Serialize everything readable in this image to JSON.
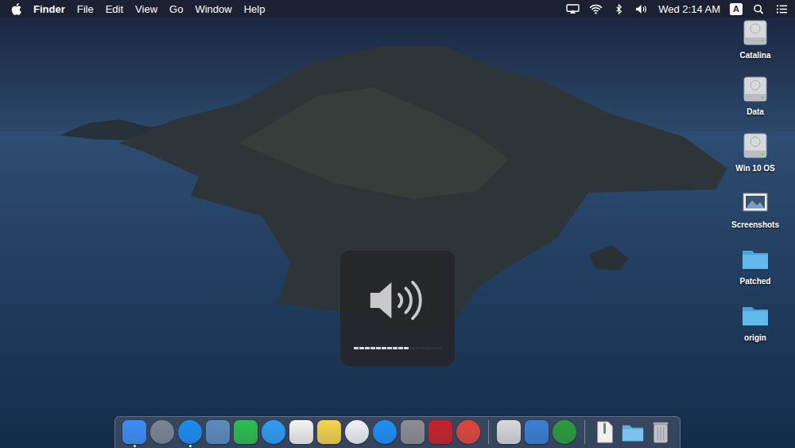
{
  "menu_bar": {
    "app": "Finder",
    "menus": [
      "File",
      "Edit",
      "View",
      "Go",
      "Window",
      "Help"
    ],
    "clock": "Wed 2:14 AM",
    "input_source": "A"
  },
  "desktop_icons": [
    {
      "label": "Catalina",
      "kind": "drive"
    },
    {
      "label": "Data",
      "kind": "drive"
    },
    {
      "label": "Win 10 OS",
      "kind": "drive"
    },
    {
      "label": "Screenshots",
      "kind": "screenshots"
    },
    {
      "label": "Patched",
      "kind": "folder"
    },
    {
      "label": "origin",
      "kind": "folder"
    }
  ],
  "volume_hud": {
    "level": 0.625,
    "muted": false
  },
  "dock": [
    {
      "kind": "app",
      "color": "#3d8ef5",
      "running": true
    },
    {
      "kind": "round-app",
      "color": "#7d8594",
      "running": false
    },
    {
      "kind": "round-app",
      "color": "#1a8cf0",
      "running": true
    },
    {
      "kind": "app",
      "color": "#5b8cc0",
      "running": false
    },
    {
      "kind": "app",
      "color": "#2dbd4e",
      "running": false
    },
    {
      "kind": "round-app",
      "color": "#2f9cf5",
      "running": false
    },
    {
      "kind": "app",
      "color": "#f2f2f2",
      "running": false
    },
    {
      "kind": "app",
      "color": "#f5d54a",
      "running": false
    },
    {
      "kind": "round-app",
      "color": "#f2f2f6",
      "running": false
    },
    {
      "kind": "round-app",
      "color": "#1d90f5",
      "running": false
    },
    {
      "kind": "app",
      "color": "#8e8e93",
      "running": false
    },
    {
      "kind": "app",
      "color": "#c8202c",
      "running": false
    },
    {
      "kind": "round-app",
      "color": "#e0453a",
      "running": false
    },
    {
      "kind": "separator",
      "color": "#ffffff",
      "running": false
    },
    {
      "kind": "app",
      "color": "#d9d9d9",
      "running": false
    },
    {
      "kind": "app",
      "color": "#3b7fd4",
      "running": false
    },
    {
      "kind": "round-app",
      "color": "#2a9d3a",
      "running": false
    },
    {
      "kind": "separator",
      "color": "#ffffff",
      "running": false
    },
    {
      "kind": "file",
      "color": "#f0f0f0",
      "running": false
    },
    {
      "kind": "folder",
      "color": "#5aaedf",
      "running": false
    },
    {
      "kind": "trash",
      "color": "#c0c4c8",
      "running": false
    }
  ]
}
